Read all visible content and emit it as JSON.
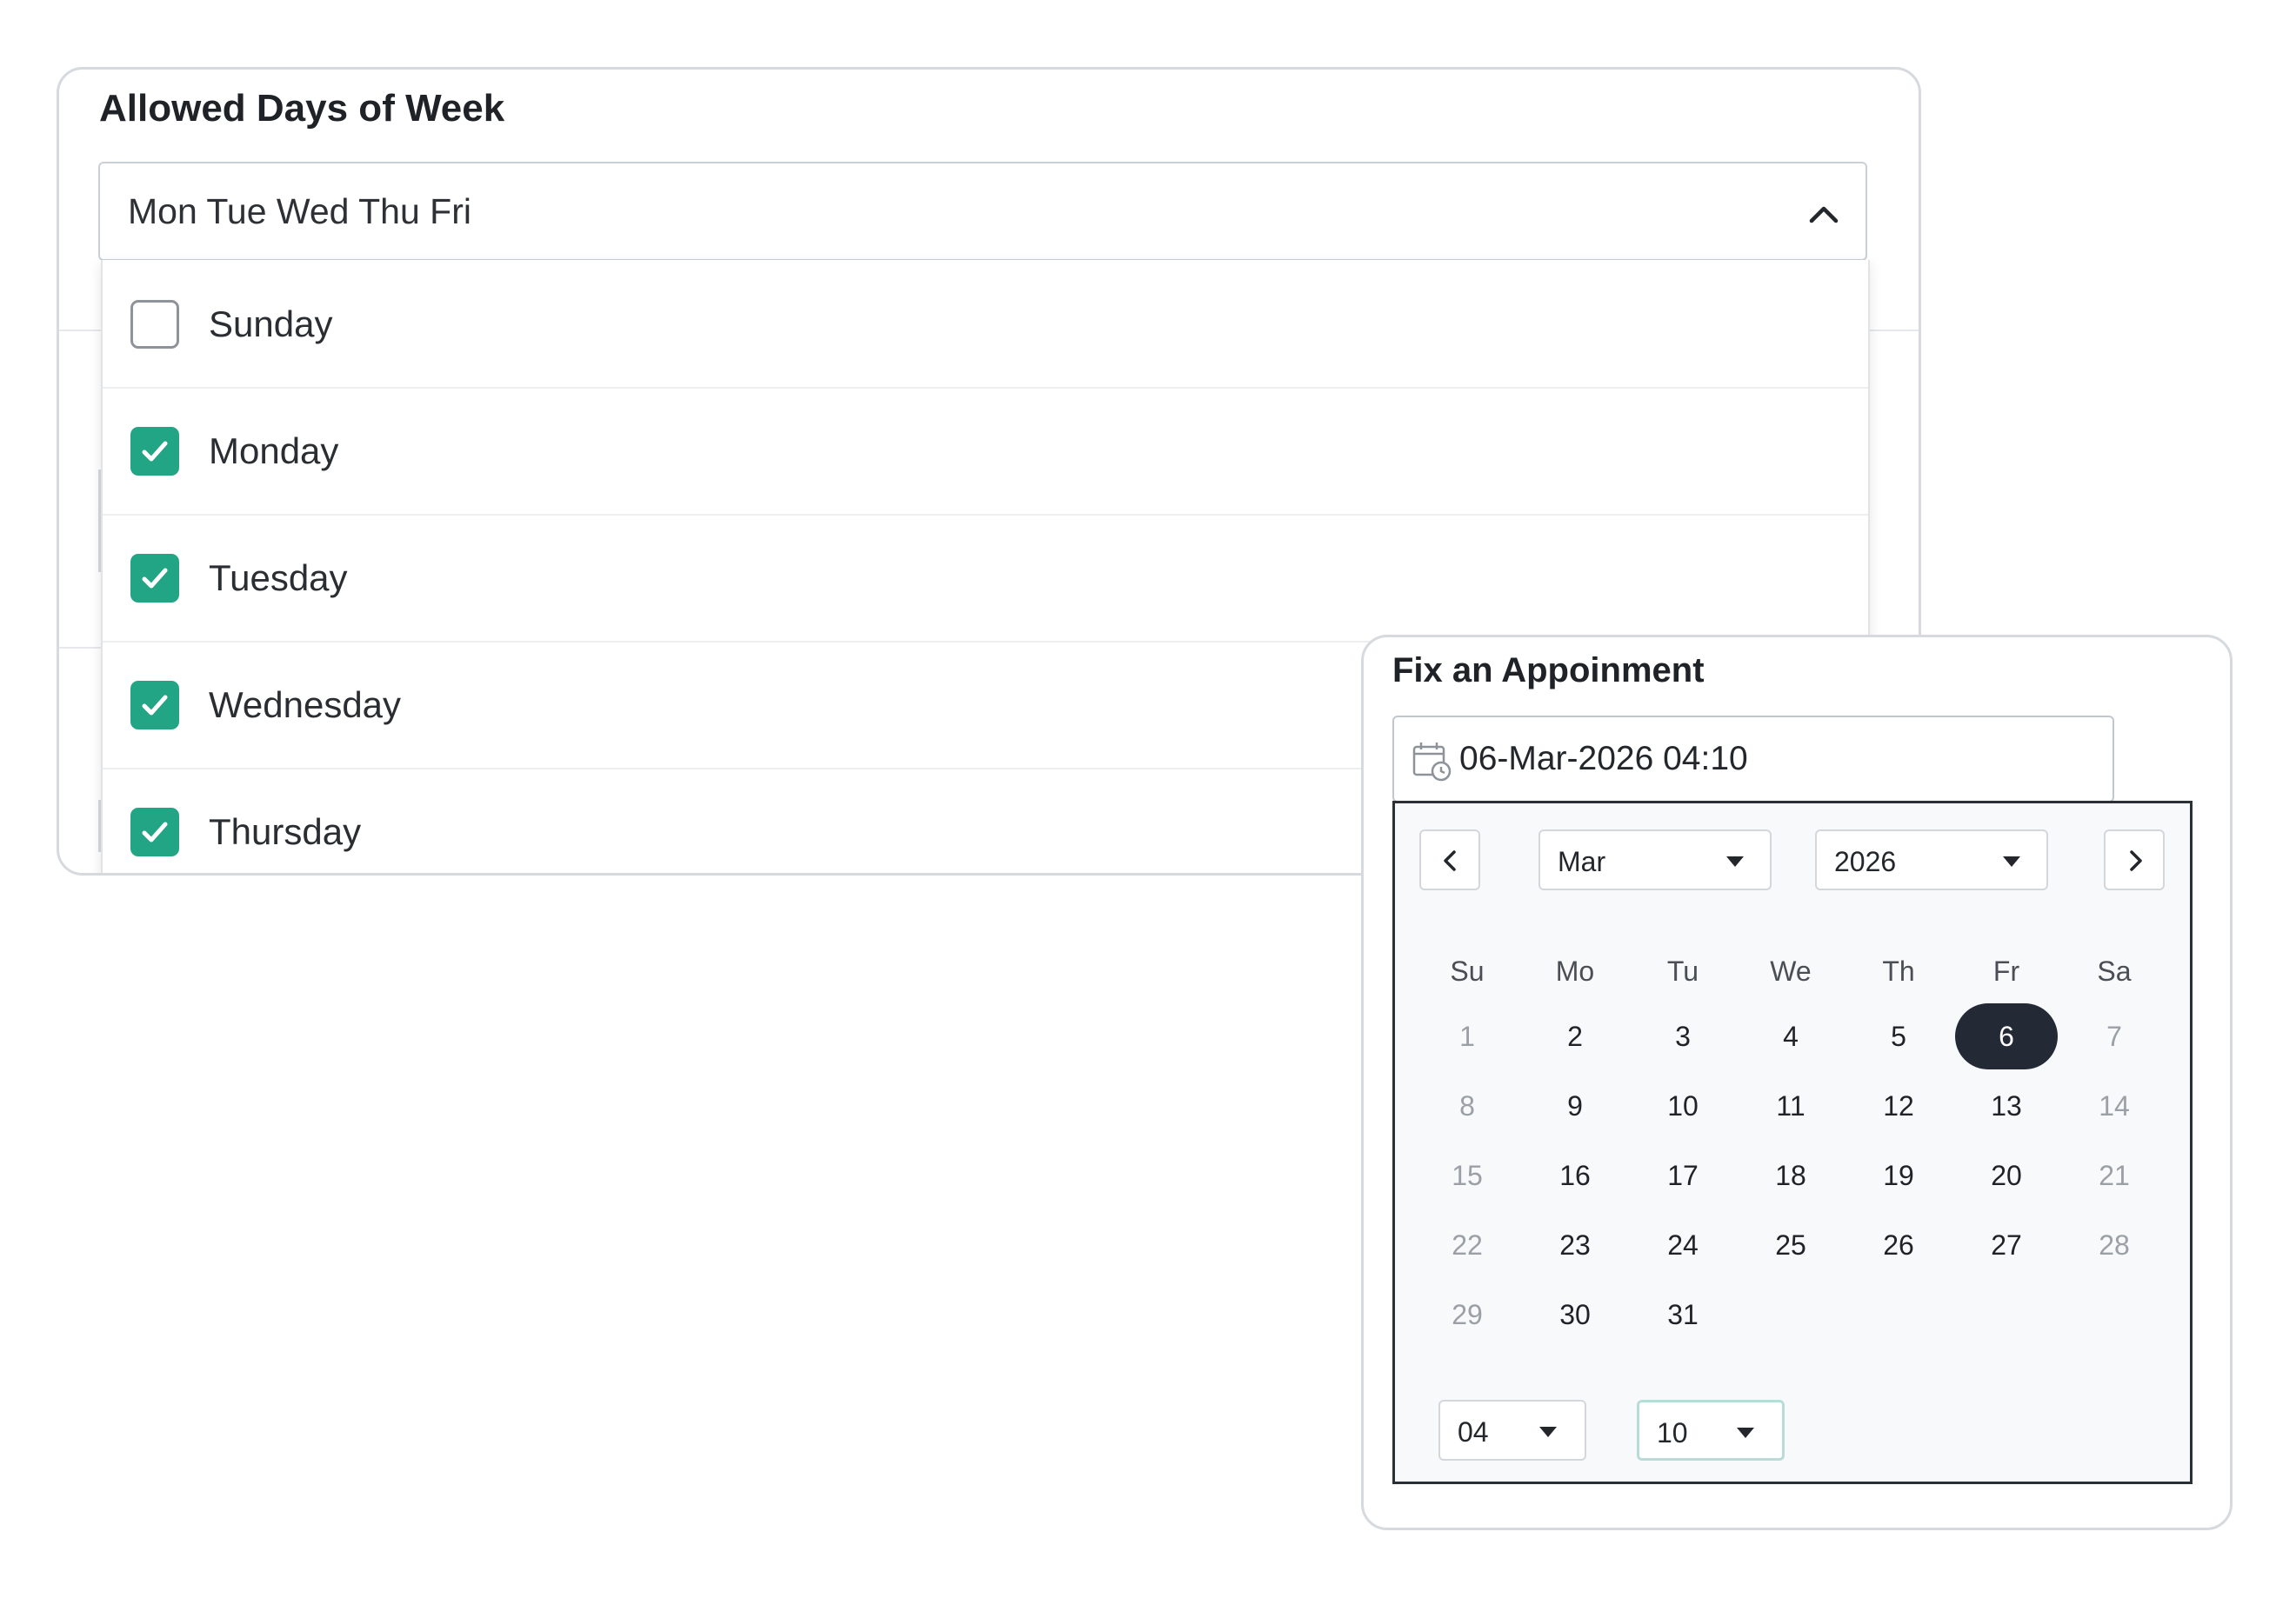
{
  "allowed_days": {
    "title": "Allowed Days of Week",
    "selected_summary": "Mon Tue Wed Thu Fri",
    "options": [
      {
        "label": "Sunday",
        "checked": false
      },
      {
        "label": "Monday",
        "checked": true
      },
      {
        "label": "Tuesday",
        "checked": true
      },
      {
        "label": "Wednesday",
        "checked": true
      },
      {
        "label": "Thursday",
        "checked": true
      }
    ],
    "chevron_icon": "chevron-up-icon",
    "check_color": "#22a584"
  },
  "appointment": {
    "title": "Fix an Appoinment",
    "value": "06-Mar-2026 04:10",
    "calendar_icon": "calendar-clock-icon",
    "month": "Mar",
    "year": "2026",
    "weekdays": [
      "Su",
      "Mo",
      "Tu",
      "We",
      "Th",
      "Fr",
      "Sa"
    ],
    "weeks": [
      [
        "1",
        "2",
        "3",
        "4",
        "5",
        "6",
        "7"
      ],
      [
        "8",
        "9",
        "10",
        "11",
        "12",
        "13",
        "14"
      ],
      [
        "15",
        "16",
        "17",
        "18",
        "19",
        "20",
        "21"
      ],
      [
        "22",
        "23",
        "24",
        "25",
        "26",
        "27",
        "28"
      ],
      [
        "29",
        "30",
        "31",
        "",
        "",
        "",
        ""
      ]
    ],
    "selected_day": "6",
    "hour": "04",
    "minute": "10",
    "selected_color": "#232935"
  }
}
